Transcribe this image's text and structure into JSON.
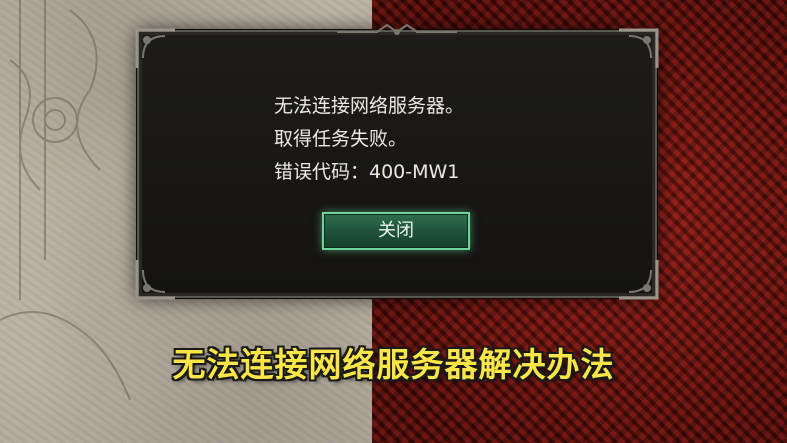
{
  "dialog": {
    "lines": [
      "无法连接网络服务器。",
      "取得任务失败。",
      "错误代码：400-MW1"
    ],
    "close_label": "关闭"
  },
  "caption": "无法连接网络服务器解决办法",
  "colors": {
    "dialog_bg": "#1a1917",
    "dialog_border": "#5b5852",
    "button_bg": "#1e5138",
    "button_border": "#6fd39b",
    "caption_text": "#fbe64a",
    "right_background": "#6a1510",
    "left_background": "#bdb5a6"
  }
}
